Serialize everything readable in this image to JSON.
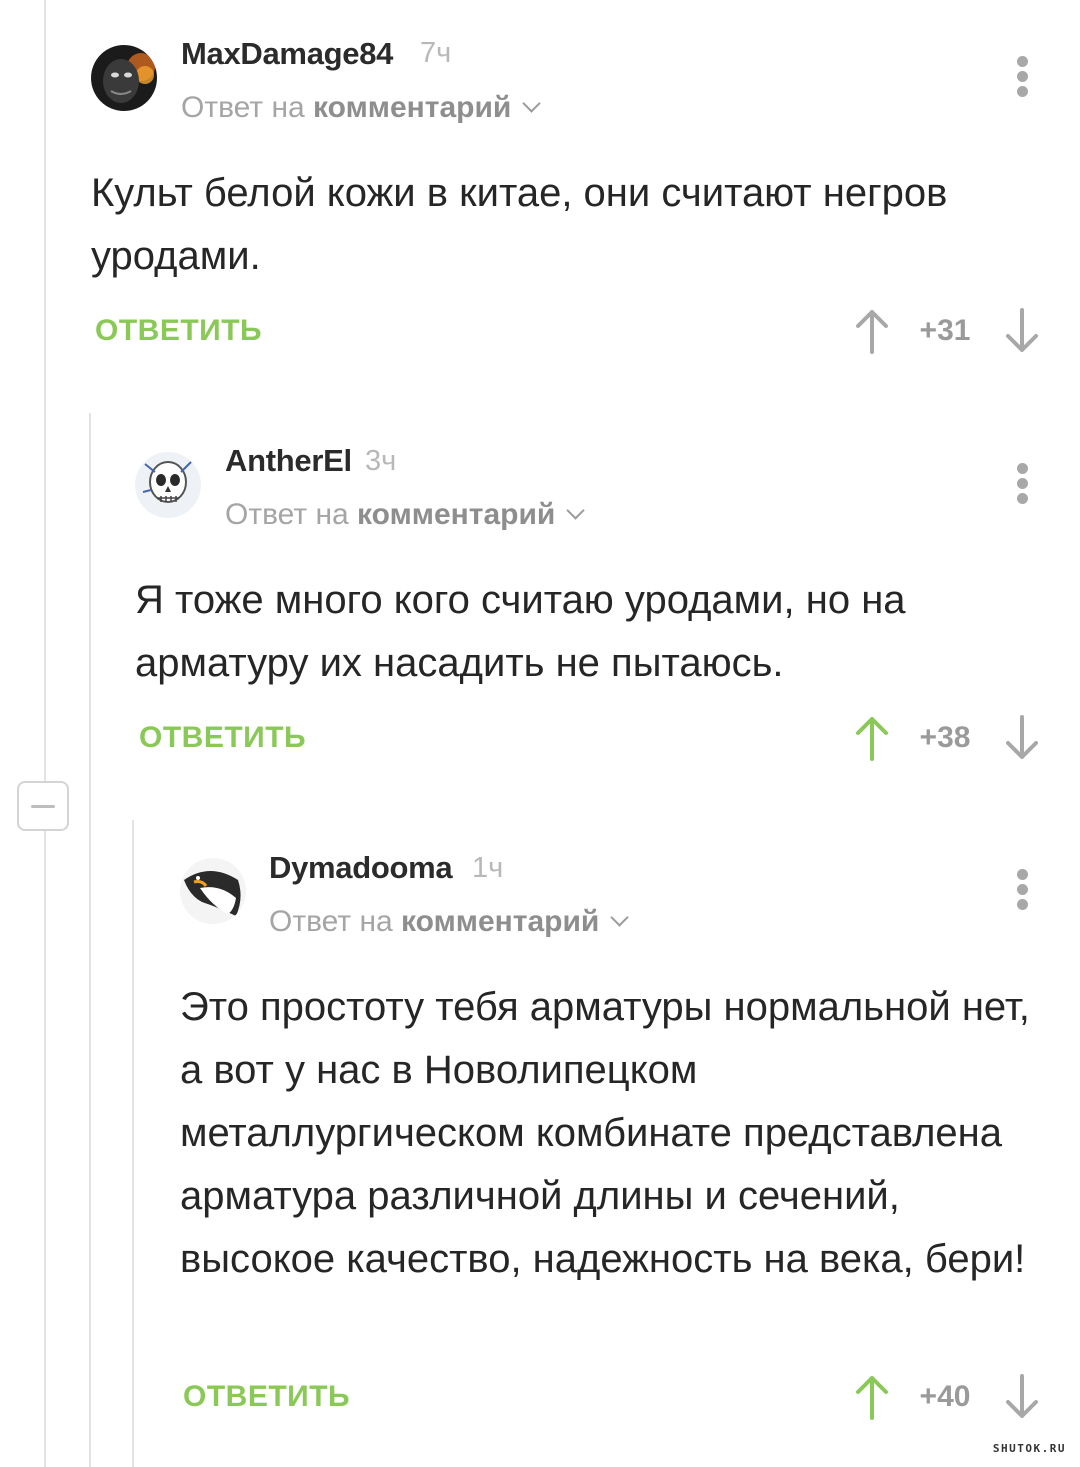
{
  "comments": [
    {
      "username": "MaxDamage84",
      "time": "7ч",
      "reply_to_prefix": "Ответ на",
      "reply_to_link": "комментарий",
      "text": "Культ белой кожи в китае, они считают негров уродами.",
      "reply_label": "ОТВЕТИТЬ",
      "rating": "+31",
      "upvoted": false,
      "avatar_icon": "dark-creature-avatar"
    },
    {
      "username": "AntherEl",
      "time": "3ч",
      "reply_to_prefix": "Ответ на",
      "reply_to_link": "комментарий",
      "text": "Я тоже много кого считаю уродами, но на арматуру их насадить не пытаюсь.",
      "reply_label": "ОТВЕТИТЬ",
      "rating": "+38",
      "upvoted": true,
      "avatar_icon": "skull-sketch-avatar"
    },
    {
      "username": "Dymadooma",
      "time": "1ч",
      "reply_to_prefix": "Ответ на",
      "reply_to_link": "комментарий",
      "text": "Это простоту тебя арматуры нормальной нет, а вот у нас в Новолипецком металлургическом комбинате представлена арматура различной длины и сечений, высокое качество, надежность на века, бери!",
      "reply_label": "ОТВЕТИТЬ",
      "rating": "+40",
      "upvoted": true,
      "avatar_icon": "penguin-avatar"
    }
  ],
  "colors": {
    "accent_green": "#8ac858",
    "upvote_active": "#8ac858",
    "vote_inactive": "#a8a8a8",
    "thread_line": "#e3e3e3"
  },
  "watermark": "SHUTOK.RU"
}
